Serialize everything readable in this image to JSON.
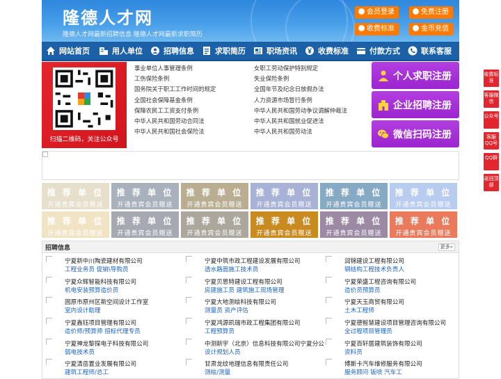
{
  "header": {
    "site_name": "隆德人才网",
    "subtitle": "隆德人才网最新招聘信息   隆德人才网最新求职简历",
    "buttons": [
      {
        "label": "会员登录",
        "icon": "user-icon"
      },
      {
        "label": "免费注册",
        "icon": "register-icon"
      },
      {
        "label": "收费标准",
        "icon": "price-icon"
      },
      {
        "label": "金币充值",
        "icon": "coin-icon"
      }
    ],
    "colors": {
      "header_bg": "#3b92e4",
      "button": "#ff7a00",
      "nav": "#1c60a8"
    }
  },
  "nav": [
    {
      "label": "网站首页",
      "icon": "home-icon"
    },
    {
      "label": "用人单位",
      "icon": "building-icon"
    },
    {
      "label": "招聘信息",
      "icon": "recruit-icon"
    },
    {
      "label": "求职简历",
      "icon": "resume-icon"
    },
    {
      "label": "职场资讯",
      "icon": "news-icon"
    },
    {
      "label": "收费标准",
      "icon": "yen-icon"
    },
    {
      "label": "付款方式",
      "icon": "payment-icon"
    },
    {
      "label": "联系客服",
      "icon": "phone-icon"
    }
  ],
  "qr": {
    "caption": "扫描二维码，关注公众号"
  },
  "policies": [
    "事业单位人事管理条例",
    "女职工劳动保护特别规定",
    "工伤保险条例",
    "失业保险条例",
    "国务院关于职工工作时间的规定",
    "全国年节及纪念日放假办法",
    "全国社会保障基金条例",
    "人力资源市场暂行条例",
    "保障农民工工资支付条例",
    "中华人民共和国劳动争议调解仲裁法",
    "中华人民共和国劳动合同法",
    "中华人民共和国就业促进法",
    "中华人民共和国社会保险法",
    "中华人民共和国劳动法"
  ],
  "register_buttons": [
    {
      "label": "个人求职注册",
      "icon": "person-icon"
    },
    {
      "label": "企业招聘注册",
      "icon": "company-icon"
    },
    {
      "label": "微信扫码注册",
      "icon": "wechat-icon"
    }
  ],
  "tiles": {
    "title": "推 荐 单 位",
    "subtitle": "开通贵宾会员赠送",
    "colors": [
      "#e6dfcc",
      "#a9b2bc",
      "#b9ae92",
      "#a8b2d6",
      "#86a9c4",
      "#b8ccf0",
      "#f1e4c4",
      "#a6a9b2",
      "#aba79c",
      "#c98a20",
      "#9c8aa4",
      "#ea7a5c"
    ]
  },
  "jobs": {
    "title": "招聘信息",
    "more": "更多»",
    "items": [
      {
        "company": "宁夏新中川陶瓷建材有限公司",
        "positions": "工程业务员 促销\\导购员"
      },
      {
        "company": "宁夏中筑市政工程建设发展有限公司",
        "positions": "透水路面施工技术员"
      },
      {
        "company": "润锦建设工程有限公司",
        "positions": "钢结构工程技术负责人"
      },
      {
        "company": "宁夏众辉智能科技有限公司",
        "positions": "机电安装预算造价员"
      },
      {
        "company": "宁夏贝思特建设工程有限公司",
        "positions": "房建施工员 建筑施工现场管理"
      },
      {
        "company": "宁夏荣盛工程咨询有限公司",
        "positions": "造价员预算员"
      },
      {
        "company": "固原市原州区新空间设计工作室",
        "positions": "室内设计助理"
      },
      {
        "company": "宁夏大地测绘科技有限公司",
        "positions": "测量员 资产评估"
      },
      {
        "company": "宁夏天玉商贸有限公司",
        "positions": "土木工程师"
      },
      {
        "company": "宁夏鑫钰项目管理有限公司",
        "positions": "造价师/预算师 招标代理专员"
      },
      {
        "company": "宁夏鸿源凯瑞市政工程集团有限公司",
        "positions": "工程预算员"
      },
      {
        "company": "宁夏德智慧建设项目管理咨询有限公司",
        "positions": "全过程项目管理员"
      },
      {
        "company": "宁夏神龙黎探电子科技有限公司",
        "positions": "弱电技术员"
      },
      {
        "company": "中测新宇（北京）信息科技有限公司宁夏分公",
        "positions": "设计规划人员"
      },
      {
        "company": "宁夏百轩居建筑装饰有限公司",
        "positions": "资料员"
      },
      {
        "company": "宁夏清岳置业发展有限公司",
        "positions": "建筑工程师/总工"
      },
      {
        "company": "甘肃龙纹地理信息有限责任公司",
        "positions": "测绘/测量"
      },
      {
        "company": "博斯卡汽车维修服务有限公司",
        "positions": "服务顾问 钣喷 汽车工"
      }
    ]
  },
  "side_float": [
    "收费标准",
    "客服微信",
    "公众号",
    "客服QQ号",
    "QQ群",
    "返回顶部"
  ]
}
